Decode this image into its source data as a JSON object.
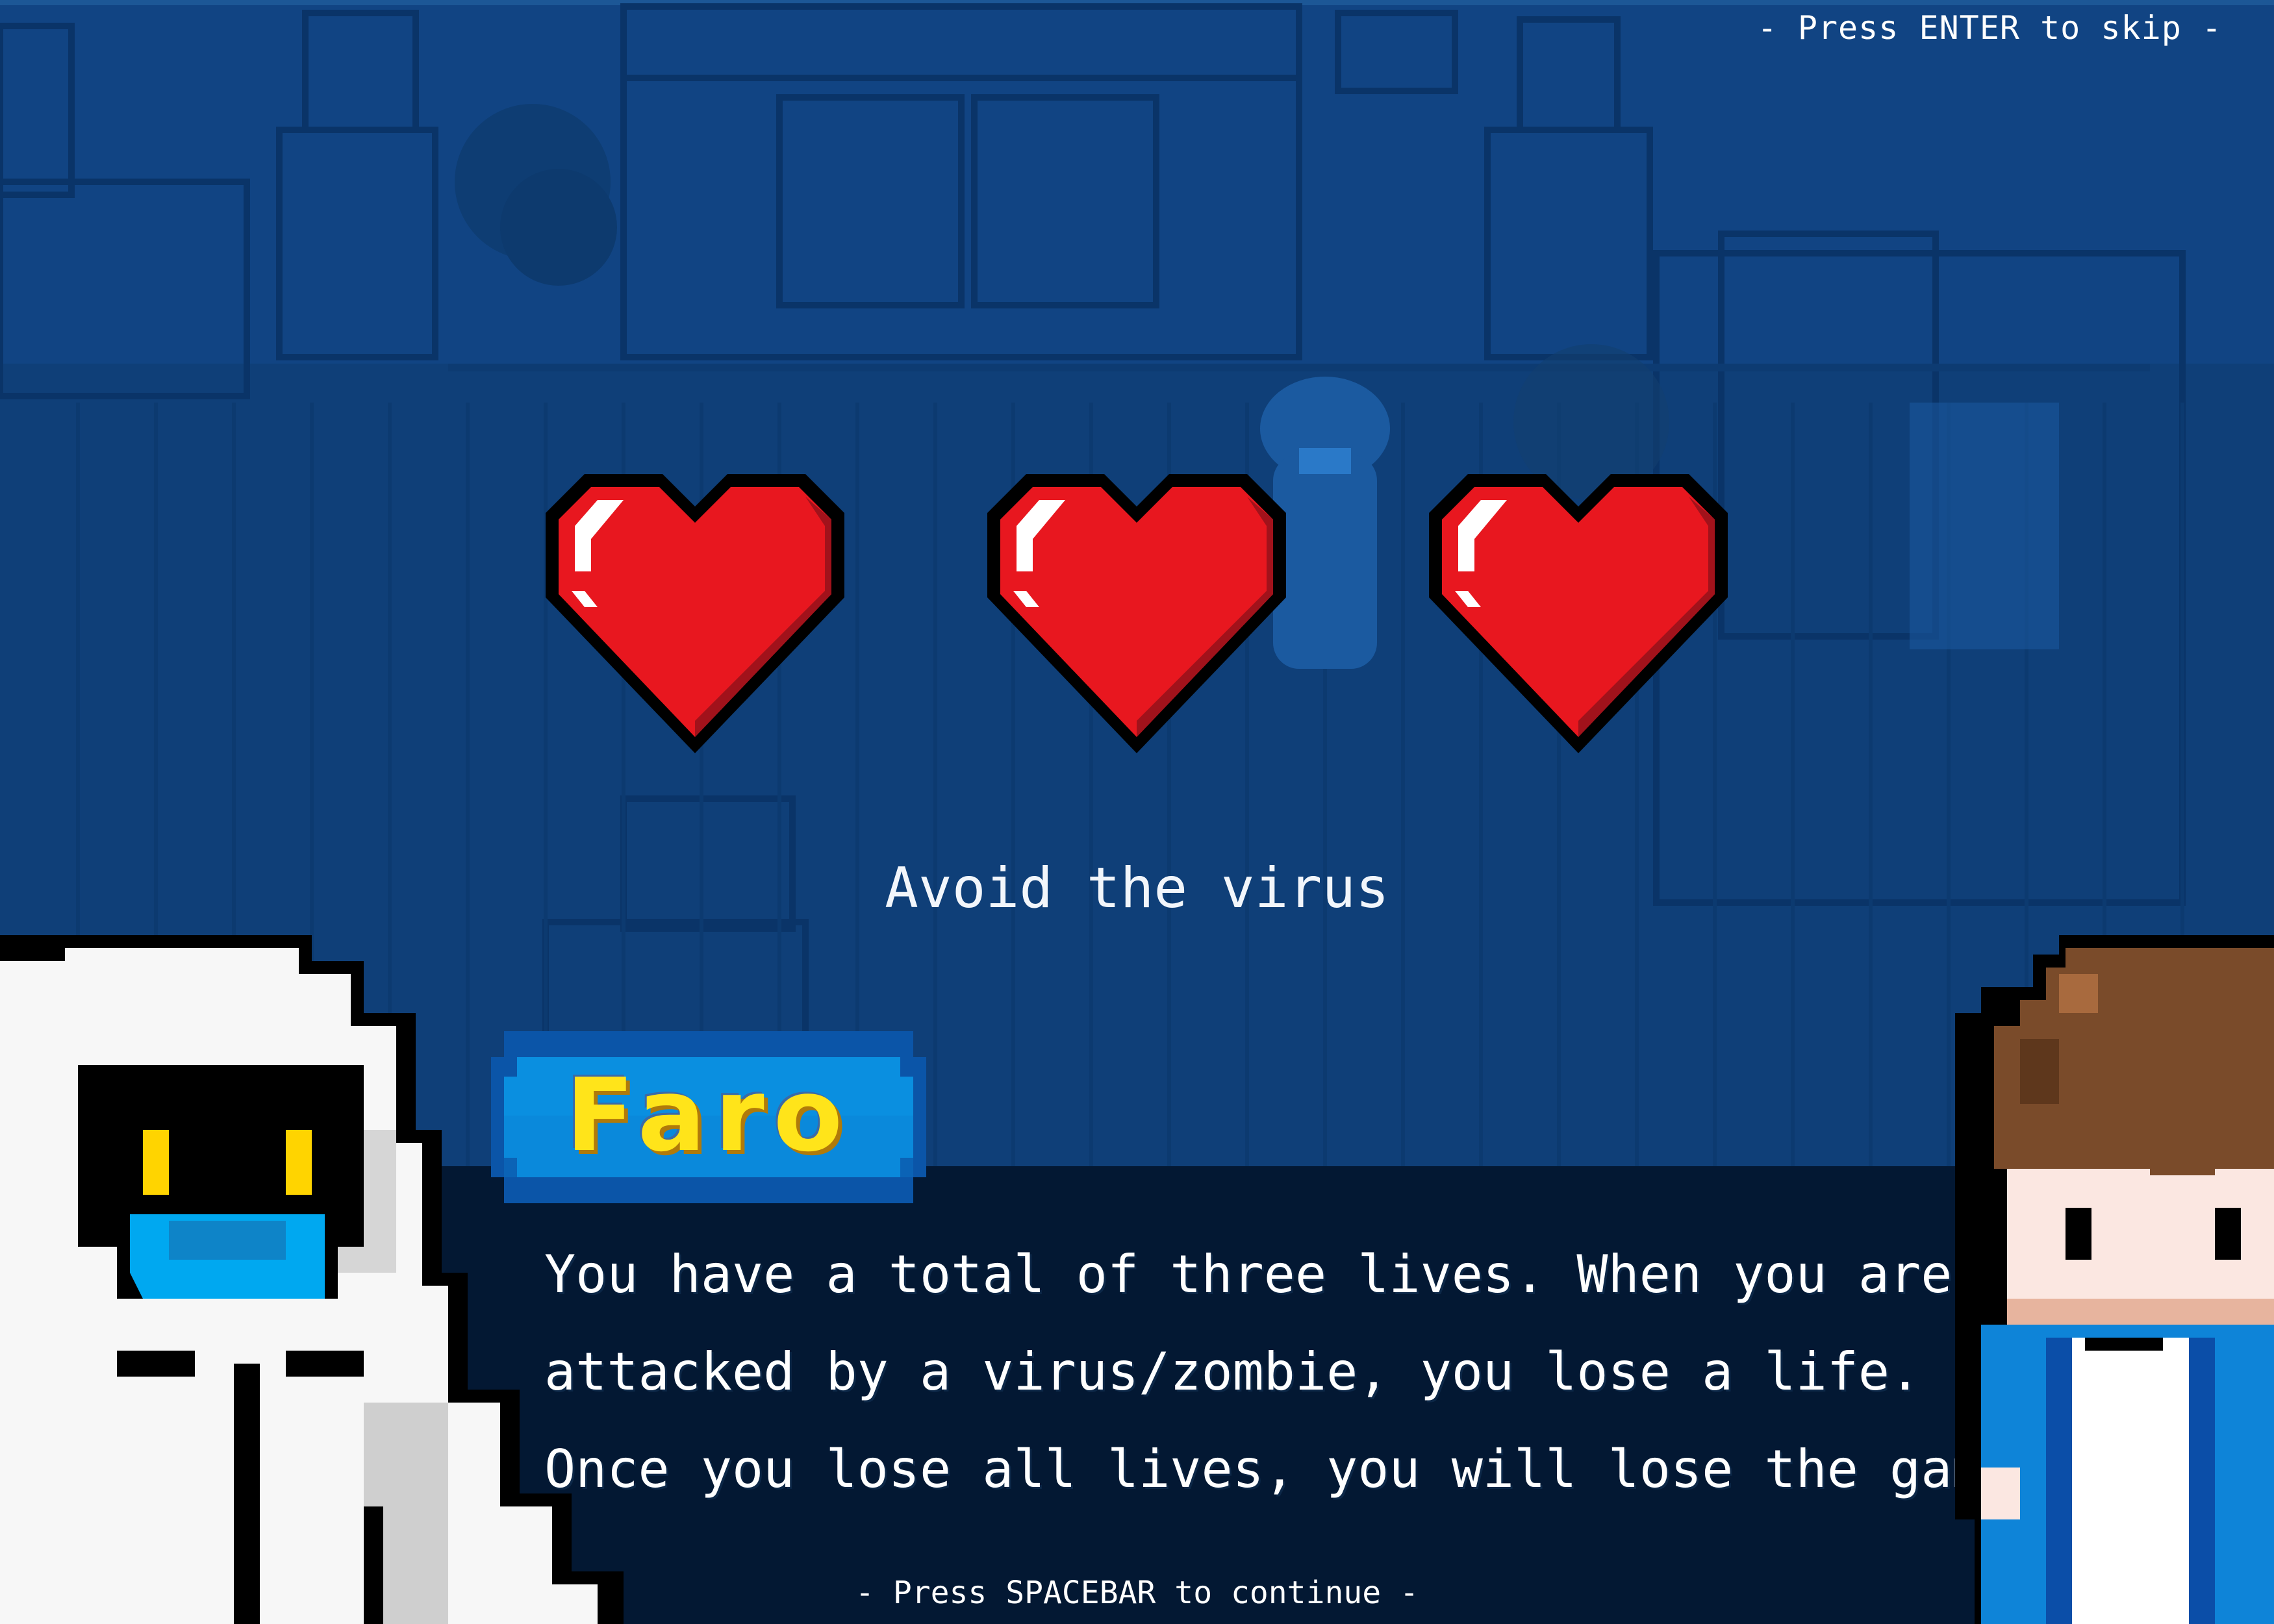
{
  "scene": {
    "background_color": "#0f3f78",
    "dialog_color": "#031833",
    "heart_color": "#e8171f"
  },
  "skip_hint": "- Press ENTER to skip -",
  "lives": {
    "total": 3,
    "remaining": 3,
    "icons": [
      "heart-icon",
      "heart-icon",
      "heart-icon"
    ]
  },
  "hint": "Avoid the virus",
  "dialog": {
    "speaker": "Faro",
    "lines": [
      "You have a total of three lives. When you are",
      "attacked by a virus/zombie, you lose a life.",
      "Once you lose all lives, you will lose the game."
    ],
    "continue_hint": "- Press SPACEBAR to continue -"
  },
  "portraits": {
    "left": "hazmat-suit-character",
    "right": "brown-haired-boy-character"
  }
}
